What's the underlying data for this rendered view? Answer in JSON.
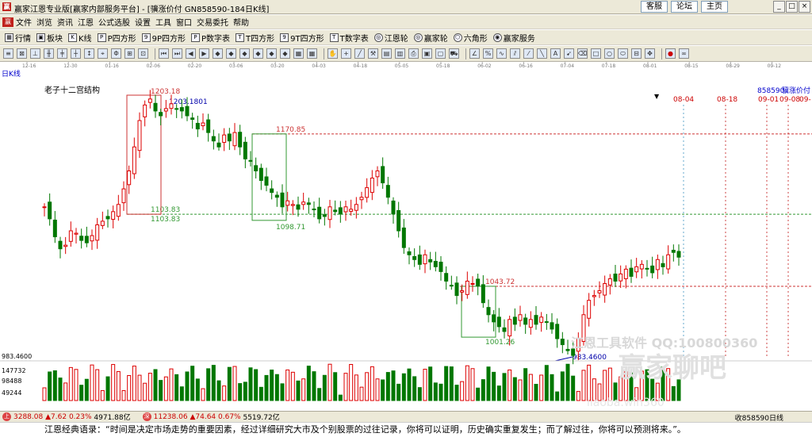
{
  "window": {
    "title": "赢家江恩专业版[赢家内部服务平台] - [骥涨价付   GN858590-184日K线]",
    "links": [
      "客服",
      "论坛",
      "主页"
    ]
  },
  "menu": [
    "文件",
    "浏览",
    "资讯",
    "江恩",
    "公式选股",
    "设置",
    "工具",
    "窗口",
    "交易委托",
    "帮助"
  ],
  "toolbar": [
    {
      "label": "行情"
    },
    {
      "label": "板块"
    },
    {
      "label": "K线"
    },
    {
      "label": "P四方形"
    },
    {
      "label": "9P四方形"
    },
    {
      "label": "P数字表"
    },
    {
      "label": "T四方形"
    },
    {
      "label": "9T四方形"
    },
    {
      "label": "T数字表"
    },
    {
      "label": "江恩轮"
    },
    {
      "label": "赢家轮"
    },
    {
      "label": "六角形"
    },
    {
      "label": "赢家服务"
    }
  ],
  "chart_meta": {
    "period": "日K线",
    "study": "老子十二宫结构",
    "code": "858590",
    "name": "骥涨价付",
    "date_ticks": [
      "12-16",
      "12-30",
      "01-16",
      "02-06",
      "02-20",
      "03-06",
      "03-20",
      "04-03",
      "04-18",
      "05-05",
      "05-18",
      "06-02",
      "06-16",
      "07-04",
      "07-18",
      "08-01",
      "08-15",
      "08-29",
      "09-12"
    ],
    "future_dates": [
      "08-04",
      "08-18",
      "09-01",
      "09-08",
      "09-"
    ],
    "price_labels": [
      "1203.18",
      "1203.1801",
      "1170.85",
      "1103.83",
      "1098.71",
      "1043.72",
      "1001.26",
      "983.4600"
    ],
    "volume_axis": [
      "983.4600",
      "147732",
      "98488",
      "49244"
    ],
    "watermark": "江恩工具软件  QQ:100800360",
    "watermark2": "赢家聊吧",
    "watermark3": "liaoba.win360"
  },
  "chart_data": {
    "type": "candlestick",
    "y_scale": [
      983.46,
      1203.18
    ]
  },
  "status": {
    "i1_value": "3288.08",
    "i1_change": "▲7.62",
    "i1_pct": "0.23%",
    "i1_amt": "4971.88亿",
    "i2_value": "11238.06",
    "i2_change": "▲74.64",
    "i2_pct": "0.67%",
    "i2_amt": "5519.72亿",
    "right": "收858590日线"
  },
  "quote": "江恩经典语录：“时间是决定市场走势的重要因素，经过详细研究大市及个别股票的过往记录，你将可以证明，历史确实重复发生；而了解过往，你将可以预测将来。”。",
  "colors": {
    "up": "#dd0000",
    "down": "#007700",
    "frame_red": "#cc3333",
    "frame_green": "#339933",
    "accent": "#cc0000"
  }
}
